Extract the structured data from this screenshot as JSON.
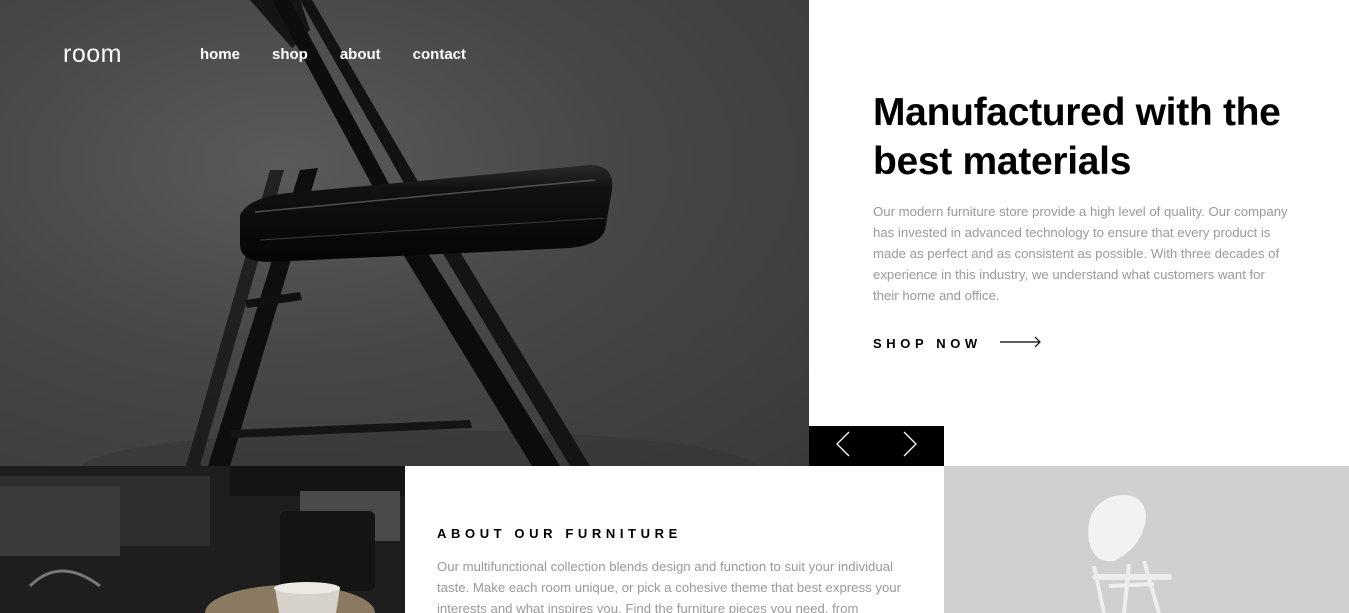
{
  "brand": {
    "logo": "room"
  },
  "nav": {
    "items": [
      "home",
      "shop",
      "about",
      "contact"
    ]
  },
  "hero": {
    "title": "Manufactured with the best materials",
    "description": "Our modern furniture store provide a high level of quality. Our company has invested in advanced technology to ensure that every product is made as perfect and as consistent as possible. With three decades of experience in this industry, we understand what customers want for their home and office.",
    "cta_label": "SHOP NOW",
    "cta_icon": "arrow-right-icon"
  },
  "slider": {
    "prev_icon": "chevron-left-icon",
    "next_icon": "chevron-right-icon"
  },
  "about": {
    "title": "ABOUT OUR FURNITURE",
    "description": "Our multifunctional collection blends design and function to suit your individual taste. Make each room unique, or pick a cohesive theme that best express your interests and what inspires you. Find the furniture pieces you need, from traditional to contemporary styles or anything in between."
  },
  "colors": {
    "text_dark": "#000000",
    "text_muted": "#9a9a9a",
    "bg_white": "#ffffff",
    "nav_text": "#ffffff"
  }
}
